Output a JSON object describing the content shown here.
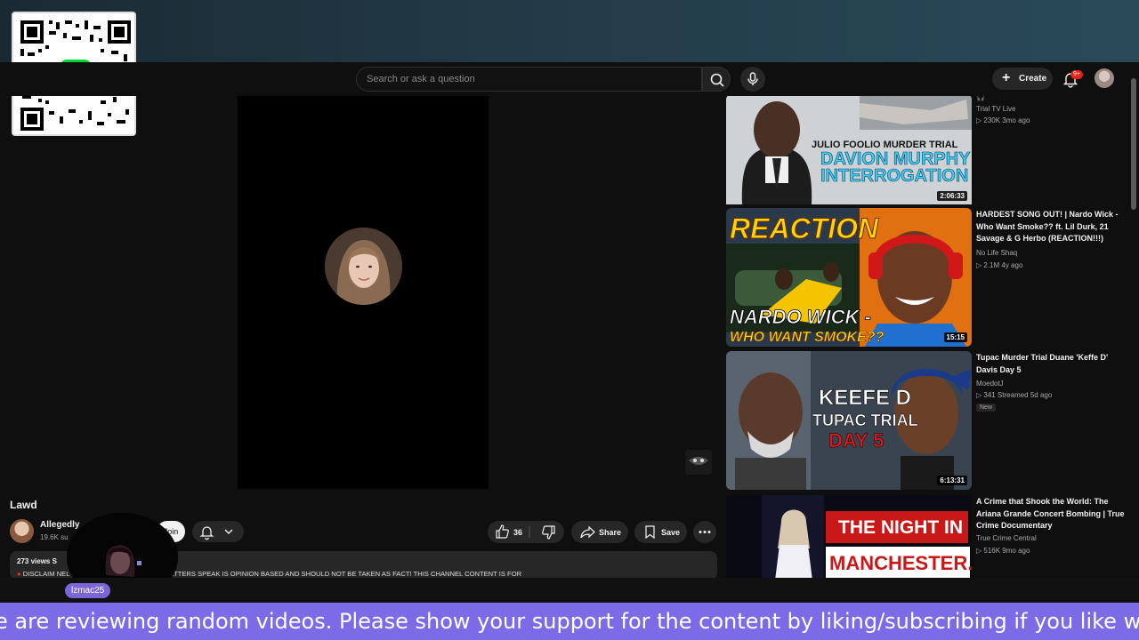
{
  "overlay": {
    "qr_logo": "$",
    "ticker_text": "e are reviewing random videos. Please show your support for the content by liking/subscribing if you like wh",
    "cam_user": "lzmac25"
  },
  "masthead": {
    "search_placeholder": "Search or ask a question",
    "create_label": "Create",
    "notif_badge": "9+"
  },
  "video": {
    "title": "Lawd",
    "channel": "Allegedly",
    "subs": "19.6K su",
    "join_label": "Join",
    "likes": "36",
    "share_label": "Share",
    "save_label": "Save",
    "views": "273 views  S",
    "description": "DISCLAIM                                          NEL HOST, CHANNEL GUEST, & CHATTERS SPEAK IS OPINION BASED AND SHOULD NOT BE TAKEN AS FACT!  THIS CHANNEL CONTENT IS FOR"
  },
  "sidebar": {
    "items": [
      {
        "title": "",
        "channel": "Trial TV Live",
        "meta": "▷ 230K  3mo ago",
        "duration": "2:06:33",
        "thumb_lines": [
          "JULIO FOOLIO MURDER TRIAL",
          "DAVION MURPHY",
          "INTERROGATION"
        ]
      },
      {
        "title": "HARDEST SONG OUT! | Nardo Wick - Who Want Smoke?? ft. Lil Durk, 21 Savage & G Herbo (REACTION!!!)",
        "channel": "No Life Shaq",
        "meta": "▷ 2.1M  4y ago",
        "duration": "15:15",
        "thumb_lines": [
          "REACTION",
          "NARDO WICK -",
          "WHO WANT SMOKE??"
        ]
      },
      {
        "title": "Tupac Murder Trial Duane 'Keffe D' Davis Day 5",
        "channel": "MoedotJ",
        "meta": "▷ 341  Streamed 5d ago",
        "badge": "New",
        "duration": "6:13:31",
        "thumb_lines": [
          "KEEFE D",
          "TUPAC TRIAL",
          "DAY 5"
        ]
      },
      {
        "title": "A Crime that Shook the World: The Ariana Grande Concert Bombing | True Crime Documentary",
        "channel": "True Crime Central",
        "meta": "▷ 516K  9mo ago",
        "duration": "",
        "thumb_lines": [
          "THE NIGHT IN",
          "MANCHESTER."
        ]
      }
    ]
  },
  "colors": {
    "ticker_bg": "#7b6be6",
    "cashapp_green": "#00d632",
    "youtube_bg": "#0f0f0f"
  }
}
